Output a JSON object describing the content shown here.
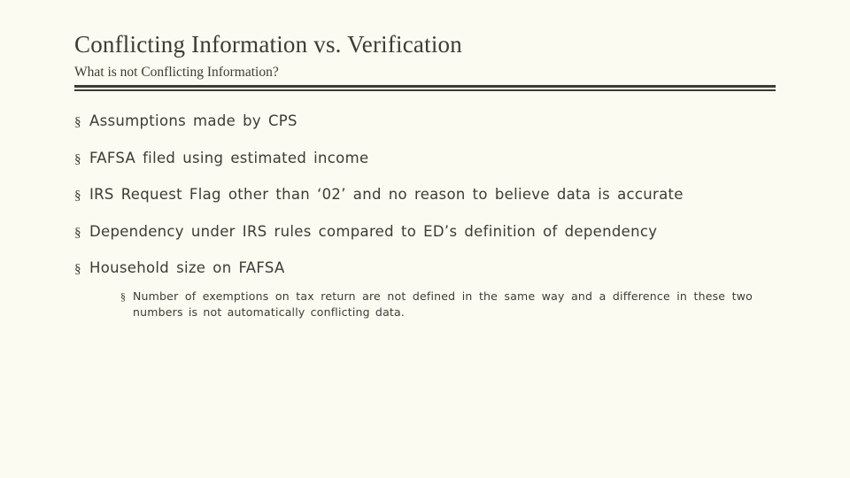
{
  "slide": {
    "title": "Conflicting Information vs. Verification",
    "subtitle": "What is not Conflicting Information?",
    "bullet_marker": "§",
    "bullets": [
      {
        "text": "Assumptions made by CPS"
      },
      {
        "text": "FAFSA filed using estimated income"
      },
      {
        "text": "IRS Request Flag other than ‘02’ and no reason to believe data is accurate"
      },
      {
        "text": "Dependency under IRS rules compared to ED’s definition of dependency"
      },
      {
        "text": "Household size on FAFSA",
        "sub_bullets": [
          {
            "text": "Number of exemptions on tax return are not defined in the same way and a difference in these two numbers is not automatically conflicting data."
          }
        ]
      }
    ]
  },
  "colors": {
    "background": "#fbfbf2",
    "text": "#3c3c34",
    "rule": "#3c3c34"
  }
}
